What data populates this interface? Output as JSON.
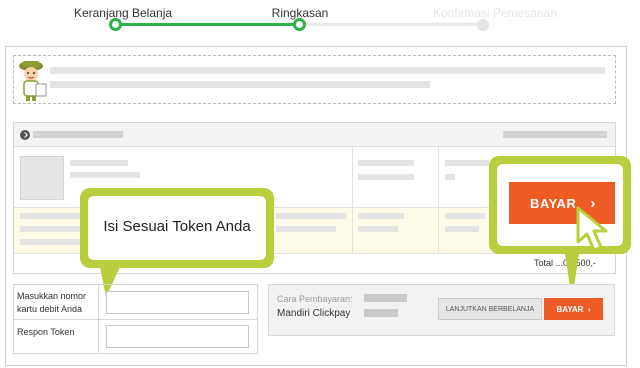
{
  "steps": [
    {
      "label": "Keranjang Belanja",
      "state": "done"
    },
    {
      "label": "Ringkasan",
      "state": "current"
    },
    {
      "label": "Konfirmasi Pemesanan",
      "state": "todo"
    }
  ],
  "colors": {
    "accent_green": "#2db34a",
    "callout": "#b9cd3d",
    "pay_orange": "#ef5b25"
  },
  "callout_token": {
    "text": "Isi Sesuai Token Anda"
  },
  "big_pay_button": {
    "label": "BAYAR",
    "icon": "chevron-right-icon"
  },
  "order": {
    "total_label": "Total",
    "total_value": "...04.500,-"
  },
  "form": {
    "card_label_line1": "Masukkan nomor",
    "card_label_line2": "kartu debit Anda",
    "token_label": "Respon Token",
    "card_value": "",
    "token_value": ""
  },
  "payment": {
    "method_label": "Cara Pembayaran:",
    "method_value": "Mandiri Clickpay",
    "continue_button": "LANJUTKAN BERBELANJA",
    "pay_button": "BAYAR",
    "pay_icon": "chevron-right-icon"
  }
}
